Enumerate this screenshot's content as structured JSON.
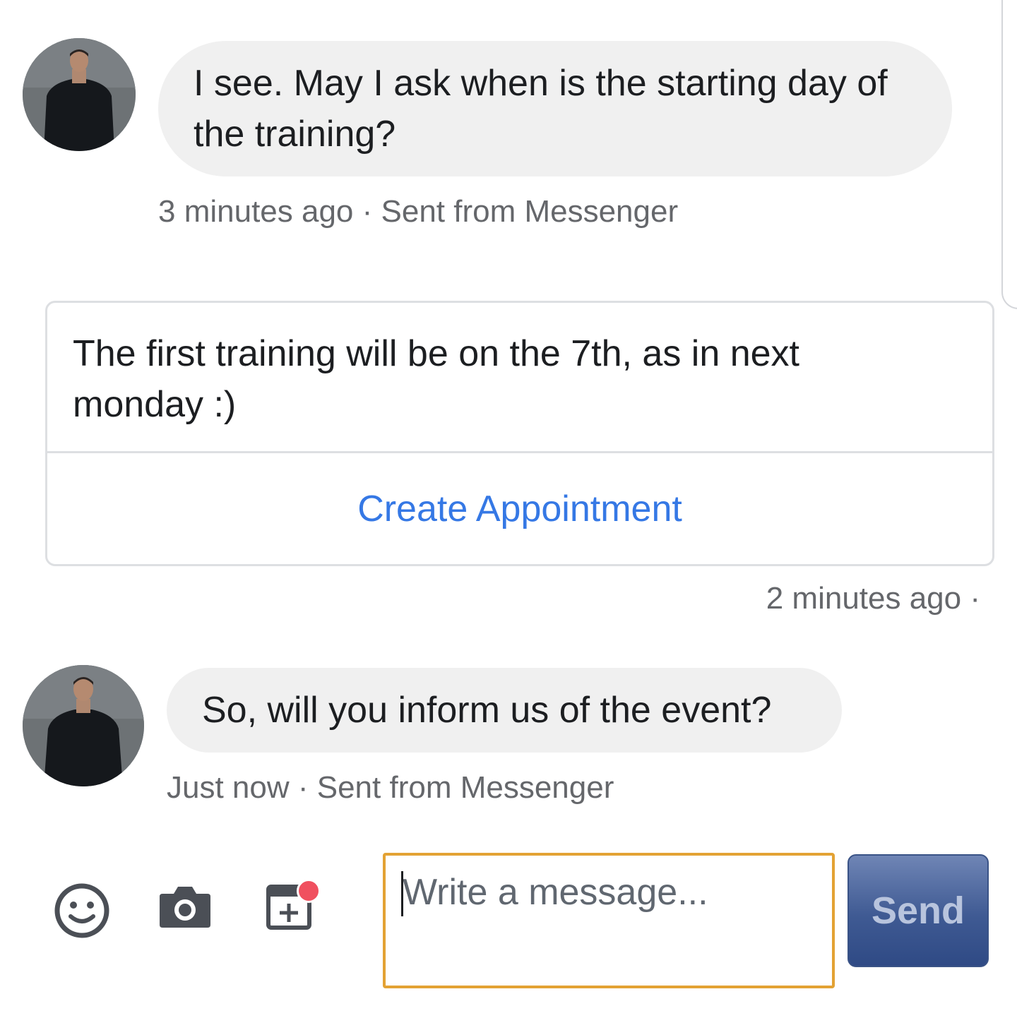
{
  "conversation": {
    "messages": [
      {
        "direction": "incoming",
        "text": "I see. May I ask when is the starting day of the training?",
        "meta": "3 minutes ago · Sent from Messenger"
      },
      {
        "direction": "outgoing",
        "text": "The first training will be on the 7th, as in next monday :)",
        "action_label": "Create Appointment",
        "meta": "2 minutes ago ·"
      },
      {
        "direction": "incoming",
        "text": "So, will you inform us of the event?",
        "meta": "Just now · Sent from Messenger"
      }
    ]
  },
  "composer": {
    "placeholder": "Write a message...",
    "value": "",
    "send_label": "Send",
    "icons": [
      "smiley-icon",
      "camera-icon",
      "calendar-add-icon"
    ],
    "notification_dot_color": "#f0505f",
    "focus_border_color": "#e3a234"
  },
  "colors": {
    "link": "#3578e5",
    "bubble_incoming": "#f0f0f0",
    "send_button": "#3f5a93"
  }
}
